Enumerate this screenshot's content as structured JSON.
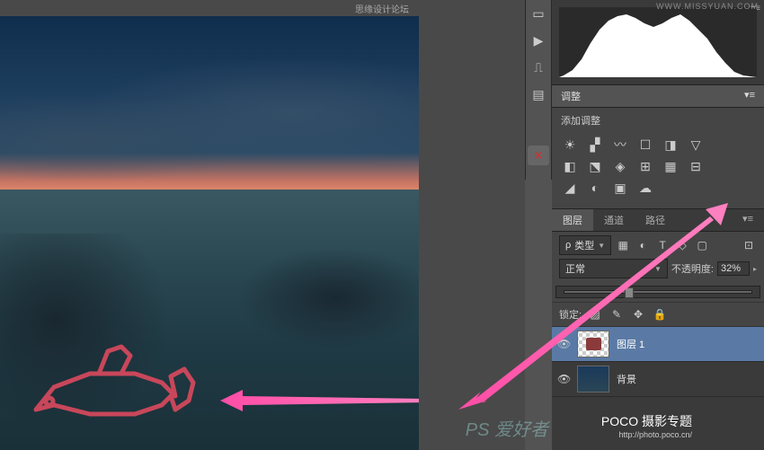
{
  "watermarks": {
    "top_center": "思缘设计论坛",
    "top_right": "WWW.MISSYUAN.COM",
    "brand": "POCO 摄影专题",
    "brand_url": "http://photo.poco.cn/",
    "ps_site": "PS 爱好者"
  },
  "toolbar": {
    "items": [
      "screen-icon",
      "play-icon",
      "stamp-icon",
      "pencil-icon",
      "x-close-icon"
    ]
  },
  "adjustments": {
    "tab": "调整",
    "add_label": "添加调整",
    "row1": [
      "brightness-icon",
      "levels-icon",
      "curves-icon",
      "exposure-icon",
      "vibrance-icon",
      "hue-icon",
      "invert-icon"
    ],
    "row2": [
      "bw-icon",
      "photo-filter-icon",
      "channel-mixer-icon",
      "color-lookup-icon",
      "posterize-icon",
      "threshold-icon"
    ],
    "row3": [
      "gradient-map-icon",
      "selective-color-icon",
      "color-fill-icon",
      "pattern-icon"
    ]
  },
  "layers": {
    "tabs": {
      "layers": "图层",
      "channels": "通道",
      "paths": "路径"
    },
    "filter_label": "类型",
    "filter_icons": [
      "image-filter",
      "adjustment-filter",
      "text-filter",
      "shape-filter",
      "smart-filter"
    ],
    "blend_mode": "正常",
    "opacity_label": "不透明度:",
    "opacity_value": "32%",
    "lock_label": "锁定:",
    "lock_icons": [
      "lock-transparent",
      "lock-brush",
      "lock-move",
      "lock-all"
    ],
    "items": [
      {
        "name": "图层 1",
        "visible": true,
        "thumb": "checker",
        "selected": true
      },
      {
        "name": "背景",
        "visible": true,
        "thumb": "photo",
        "selected": false
      }
    ]
  }
}
